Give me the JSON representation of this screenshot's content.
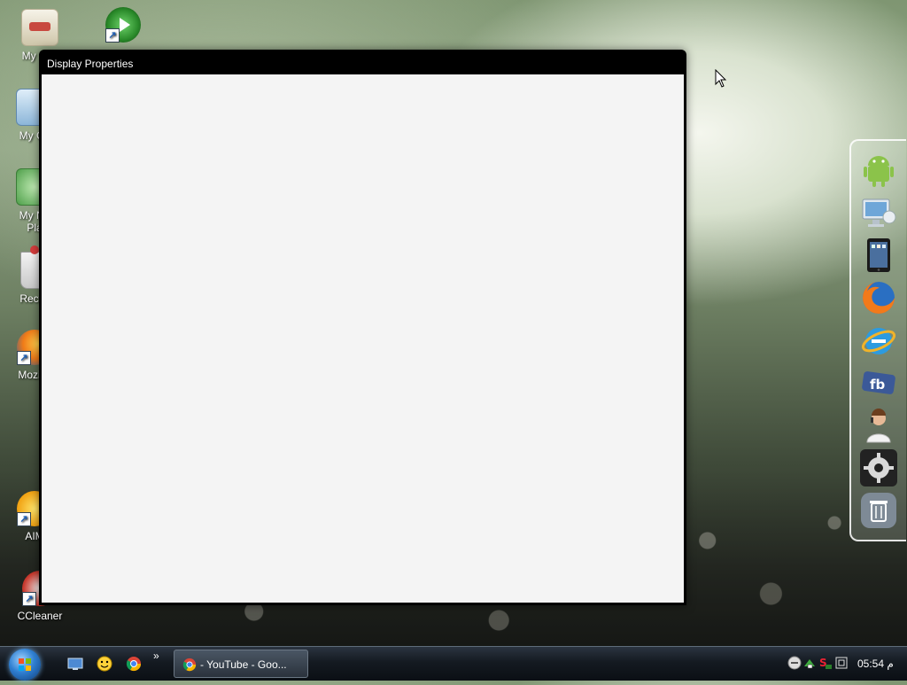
{
  "desktop": {
    "icons": [
      {
        "label": "My Doc"
      },
      {
        "label": ""
      },
      {
        "label": "My Co"
      },
      {
        "label": "My Ne\nPla"
      },
      {
        "label": "Recyc"
      },
      {
        "label": "Mozilla"
      },
      {
        "label": "AIM"
      },
      {
        "label": "CCleaner"
      }
    ]
  },
  "dialog": {
    "title": "Display Properties"
  },
  "dock": {
    "items": [
      "android-icon",
      "computer-icon",
      "tablet-icon",
      "firefox-icon",
      "internet-explorer-icon",
      "facebook-icon",
      "user-support-icon",
      "settings-gear-icon",
      "trash-icon"
    ]
  },
  "taskbar": {
    "quick_launch_more": "»",
    "task_button_label": "- YouTube - Goo...",
    "clock": "05:54 م"
  },
  "colors": {
    "dialog_frame": "#000000",
    "dialog_client": "#f4f4f4",
    "taskbar": "#141a21"
  }
}
